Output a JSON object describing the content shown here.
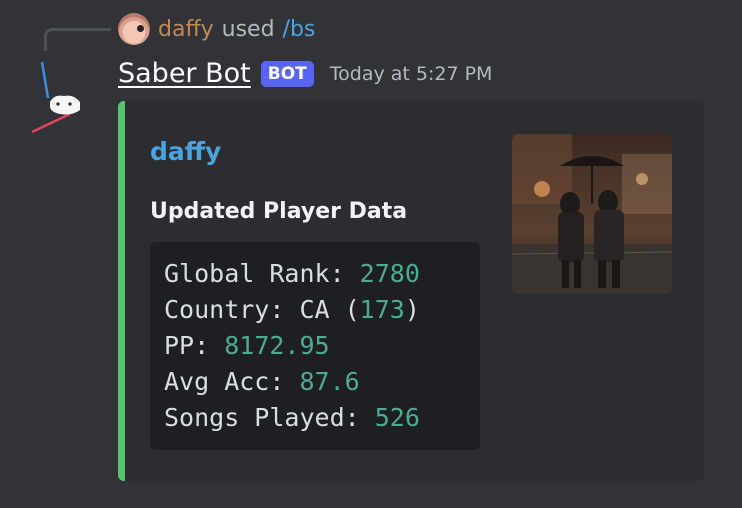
{
  "reply": {
    "username": "daffy",
    "used_text": "used",
    "command": "/bs"
  },
  "message": {
    "author": "Saber Bot",
    "bot_tag": "BOT",
    "timestamp": "Today at 5:27 PM"
  },
  "embed": {
    "accent_color": "#57c46e",
    "author": "daffy",
    "title": "Updated Player Data",
    "stats": {
      "global_rank_label": "Global Rank: ",
      "global_rank_value": "2780",
      "country_label": "Country: CA (",
      "country_rank_value": "173",
      "country_close": ")",
      "pp_label": "PP: ",
      "pp_value": "8172.95",
      "avg_acc_label": "Avg Acc: ",
      "avg_acc_value": "87.6",
      "songs_played_label": "Songs Played: ",
      "songs_played_value": "526"
    }
  }
}
